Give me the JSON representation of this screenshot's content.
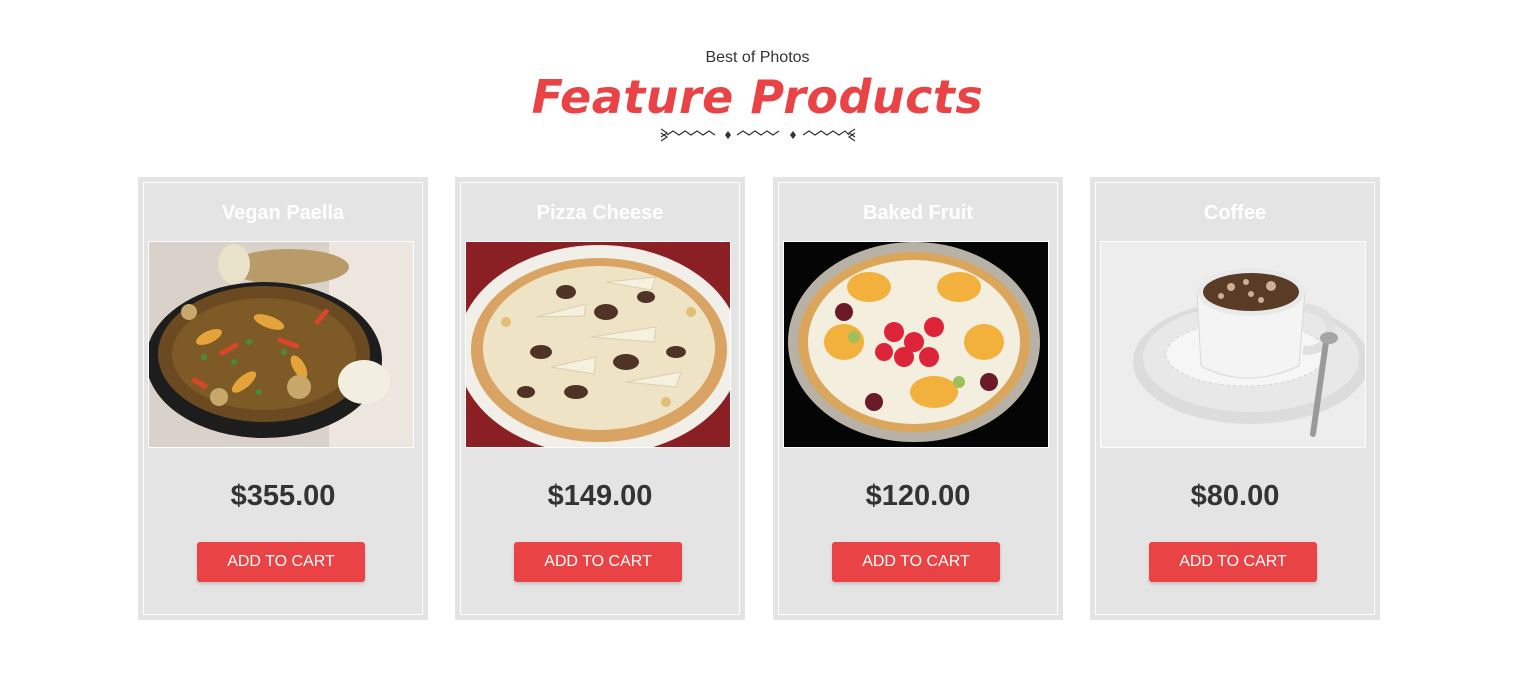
{
  "header": {
    "eyebrow": "Best of Photos",
    "title": "Feature Products"
  },
  "products": [
    {
      "name": "Vegan Paella",
      "price": "$355.00",
      "button_label": "ADD TO CART",
      "image_icon": "paella-photo"
    },
    {
      "name": "Pizza Cheese",
      "price": "$149.00",
      "button_label": "ADD TO CART",
      "image_icon": "pizza-photo"
    },
    {
      "name": "Baked Fruit",
      "price": "$120.00",
      "button_label": "ADD TO CART",
      "image_icon": "fruit-tart-photo"
    },
    {
      "name": "Coffee",
      "price": "$80.00",
      "button_label": "ADD TO CART",
      "image_icon": "coffee-cup-photo"
    }
  ],
  "colors": {
    "accent": "#e94345",
    "card_bg": "#e4e4e4",
    "text_dark": "#333333"
  }
}
